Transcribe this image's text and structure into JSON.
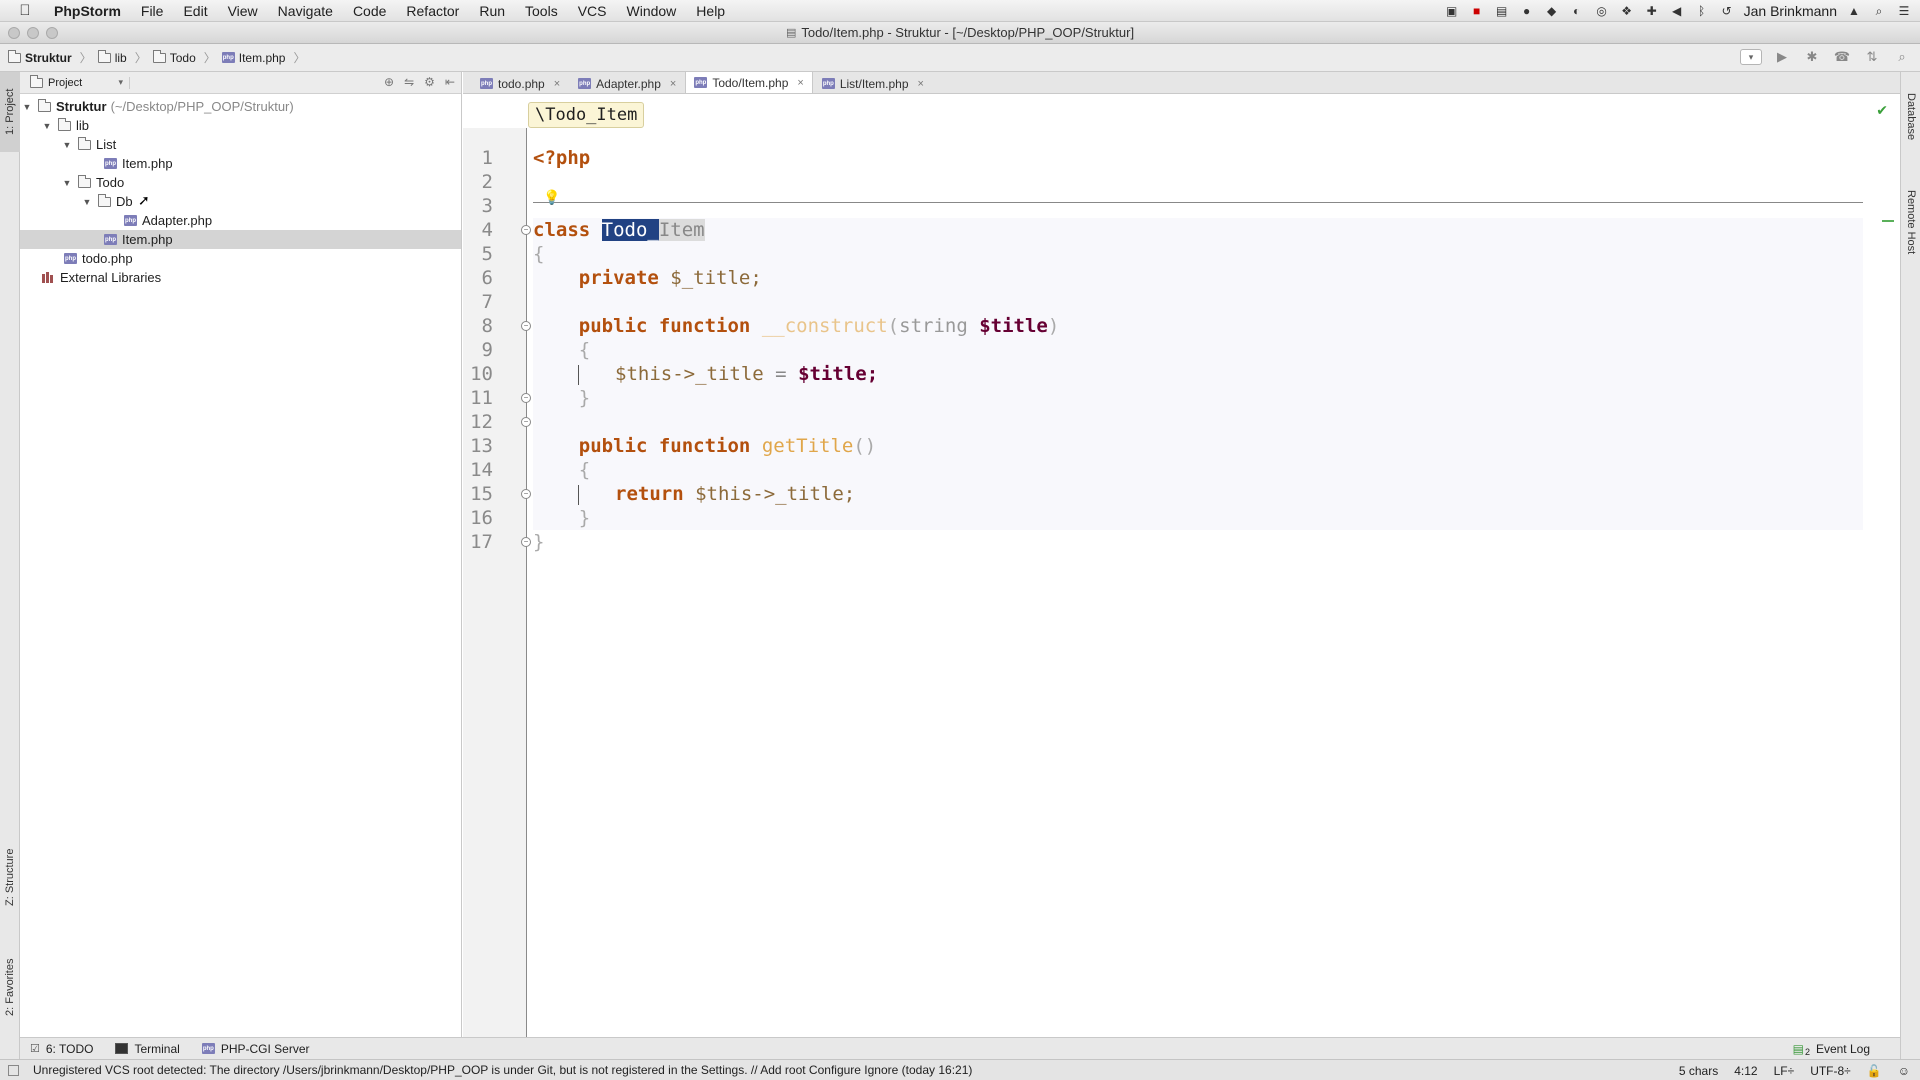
{
  "menubar": {
    "app_name": "PhpStorm",
    "items": [
      "File",
      "Edit",
      "View",
      "Navigate",
      "Code",
      "Refactor",
      "Run",
      "Tools",
      "VCS",
      "Window",
      "Help"
    ],
    "user": "Jan Brinkmann"
  },
  "window": {
    "title": "Todo/Item.php - Struktur - [~/Desktop/PHP_OOP/Struktur]"
  },
  "navbar": {
    "breadcrumbs": [
      "Struktur",
      "lib",
      "Todo",
      "Item.php"
    ]
  },
  "project_panel": {
    "selector_label": "Project",
    "tree": {
      "root_name": "Struktur",
      "root_path": "(~/Desktop/PHP_OOP/Struktur)",
      "lib": "lib",
      "list": "List",
      "list_item": "Item.php",
      "todo": "Todo",
      "db": "Db",
      "adapter": "Adapter.php",
      "todo_item": "Item.php",
      "todo_php": "todo.php",
      "external": "External Libraries"
    }
  },
  "left_strip": {
    "project_tab": "1: Project",
    "structure_tab": "Z: Structure",
    "favorites_tab": "2: Favorites"
  },
  "right_strip": {
    "database_tab": "Database",
    "remote_host_tab": "Remote Host"
  },
  "editor": {
    "tabs": [
      {
        "label": "todo.php",
        "active": false
      },
      {
        "label": "Adapter.php",
        "active": false
      },
      {
        "label": "Todo/Item.php",
        "active": true
      },
      {
        "label": "List/Item.php",
        "active": false
      }
    ],
    "breadcrumb": "\\Todo_Item",
    "line_numbers": [
      "1",
      "2",
      "3",
      "4",
      "5",
      "6",
      "7",
      "8",
      "9",
      "10",
      "11",
      "12",
      "13",
      "14",
      "15",
      "16",
      "17"
    ],
    "code": {
      "open_tag": "<?php",
      "kw_class": "class",
      "class_sel": "Todo_",
      "class_rest": "Item",
      "brace_open": "{",
      "brace_close": "}",
      "kw_private": "private",
      "prop": "$_title;",
      "kw_public": "public",
      "kw_function": "function",
      "ctor_name": "__construct",
      "paren_open": "(",
      "paren_close": ")",
      "type_string": "string",
      "param": "$title",
      "this_title": "$this->_title",
      "eq": "=",
      "assign_val": "$title;",
      "getter_name": "getTitle",
      "empty_parens": "()",
      "kw_return": "return",
      "return_expr": "$this->_title;"
    }
  },
  "bottom_tabs": {
    "todo": "6: TODO",
    "terminal": "Terminal",
    "php_cgi": "PHP-CGI Server",
    "event_log": "Event Log",
    "event_log_count": "2"
  },
  "statusbar": {
    "message": "Unregistered VCS root detected: The directory /Users/jbrinkmann/Desktop/PHP_OOP is under Git, but is not registered in the Settings. // Add root  Configure  Ignore (today 16:21)",
    "chars": "5 chars",
    "position": "4:12",
    "line_sep": "LF÷",
    "encoding": "UTF-8÷"
  }
}
